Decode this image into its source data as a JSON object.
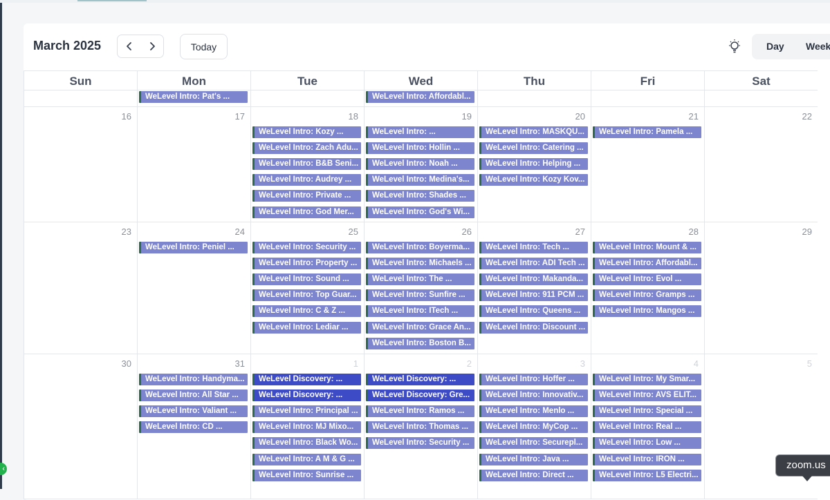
{
  "calendar": {
    "month_title": "March 2025",
    "nav": {
      "prev_icon": "chevron-left-icon",
      "next_icon": "chevron-right-icon"
    },
    "today_label": "Today",
    "theme_icon": "lightbulb-icon",
    "views": [
      "Day",
      "Week"
    ],
    "weekdays": [
      "Sun",
      "Mon",
      "Tue",
      "Wed",
      "Thu",
      "Fri",
      "Sat"
    ],
    "colors": {
      "event": "#7e85cf",
      "event_discovery": "#3e4bc6",
      "event_stripe": "#2e6b4a"
    },
    "weeks": [
      {
        "days": [
          {
            "num": "",
            "other": false,
            "events": []
          },
          {
            "num": "",
            "other": false,
            "events": [
              {
                "title": "WeLevel Intro: Pat's ...",
                "kind": "intro"
              }
            ]
          },
          {
            "num": "",
            "other": false,
            "events": []
          },
          {
            "num": "",
            "other": false,
            "events": [
              {
                "title": "WeLevel Intro: Affordabl...",
                "kind": "intro"
              }
            ]
          },
          {
            "num": "",
            "other": false,
            "events": []
          },
          {
            "num": "",
            "other": false,
            "events": []
          },
          {
            "num": "",
            "other": false,
            "events": []
          }
        ]
      },
      {
        "days": [
          {
            "num": "16",
            "other": false,
            "events": []
          },
          {
            "num": "17",
            "other": false,
            "events": []
          },
          {
            "num": "18",
            "other": false,
            "events": [
              {
                "title": "WeLevel Intro: Kozy ...",
                "kind": "intro"
              },
              {
                "title": "WeLevel Intro: Zach Adu...",
                "kind": "intro"
              },
              {
                "title": "WeLevel Intro: B&B Seni...",
                "kind": "intro"
              },
              {
                "title": "WeLevel Intro: Audrey ...",
                "kind": "intro"
              },
              {
                "title": "WeLevel Intro: Private ...",
                "kind": "intro"
              },
              {
                "title": "WeLevel Intro: God Mer...",
                "kind": "intro"
              }
            ]
          },
          {
            "num": "19",
            "other": false,
            "events": [
              {
                "title": "WeLevel Intro: ...",
                "kind": "intro"
              },
              {
                "title": "WeLevel Intro: Hollin ...",
                "kind": "intro"
              },
              {
                "title": "WeLevel Intro: Noah ...",
                "kind": "intro"
              },
              {
                "title": "WeLevel Intro: Medina's...",
                "kind": "intro"
              },
              {
                "title": "WeLevel Intro: Shades ...",
                "kind": "intro"
              },
              {
                "title": "WeLevel Intro: God's Wi...",
                "kind": "intro"
              }
            ]
          },
          {
            "num": "20",
            "other": false,
            "events": [
              {
                "title": "WeLevel Intro: MASKQU...",
                "kind": "intro"
              },
              {
                "title": "WeLevel Intro: Catering ...",
                "kind": "intro"
              },
              {
                "title": "WeLevel Intro: Helping ...",
                "kind": "intro"
              },
              {
                "title": "WeLevel Intro: Kozy Kov...",
                "kind": "intro"
              }
            ]
          },
          {
            "num": "21",
            "other": false,
            "events": [
              {
                "title": "WeLevel Intro: Pamela ...",
                "kind": "intro"
              }
            ]
          },
          {
            "num": "22",
            "other": false,
            "events": []
          }
        ]
      },
      {
        "days": [
          {
            "num": "23",
            "other": false,
            "events": []
          },
          {
            "num": "24",
            "other": false,
            "events": [
              {
                "title": "WeLevel Intro: Peniel ...",
                "kind": "intro"
              }
            ]
          },
          {
            "num": "25",
            "other": false,
            "events": [
              {
                "title": "WeLevel Intro: Security ...",
                "kind": "intro"
              },
              {
                "title": "WeLevel Intro: Property ...",
                "kind": "intro"
              },
              {
                "title": "WeLevel Intro: Sound ...",
                "kind": "intro"
              },
              {
                "title": "WeLevel Intro: Top Guar...",
                "kind": "intro"
              },
              {
                "title": "WeLevel Intro: C & Z ...",
                "kind": "intro"
              },
              {
                "title": "WeLevel Intro: Lediar ...",
                "kind": "intro"
              }
            ]
          },
          {
            "num": "26",
            "other": false,
            "events": [
              {
                "title": "WeLevel Intro: Boyerma...",
                "kind": "intro"
              },
              {
                "title": "WeLevel Intro: Michaels ...",
                "kind": "intro"
              },
              {
                "title": "WeLevel Intro: The ...",
                "kind": "intro"
              },
              {
                "title": "WeLevel Intro: Sunfire ...",
                "kind": "intro"
              },
              {
                "title": "WeLevel Intro: ITech ...",
                "kind": "intro"
              },
              {
                "title": "WeLevel Intro: Grace An...",
                "kind": "intro"
              },
              {
                "title": "WeLevel Intro: Boston B...",
                "kind": "intro"
              }
            ]
          },
          {
            "num": "27",
            "other": false,
            "events": [
              {
                "title": "WeLevel Intro: Tech ...",
                "kind": "intro"
              },
              {
                "title": "WeLevel Intro: ADI Tech ...",
                "kind": "intro"
              },
              {
                "title": "WeLevel Intro: Makanda...",
                "kind": "intro"
              },
              {
                "title": "WeLevel Intro: 911 PCM ...",
                "kind": "intro"
              },
              {
                "title": "WeLevel Intro: Queens ...",
                "kind": "intro"
              },
              {
                "title": "WeLevel Intro: Discount ...",
                "kind": "intro"
              }
            ]
          },
          {
            "num": "28",
            "other": false,
            "events": [
              {
                "title": "WeLevel Intro: Mount & ...",
                "kind": "intro"
              },
              {
                "title": "WeLevel Intro: Affordabl...",
                "kind": "intro"
              },
              {
                "title": "WeLevel Intro: Evol ...",
                "kind": "intro"
              },
              {
                "title": "WeLevel Intro: Gramps ...",
                "kind": "intro"
              },
              {
                "title": "WeLevel Intro: Mangos ...",
                "kind": "intro"
              }
            ]
          },
          {
            "num": "29",
            "other": false,
            "events": []
          }
        ]
      },
      {
        "days": [
          {
            "num": "30",
            "other": false,
            "events": []
          },
          {
            "num": "31",
            "other": false,
            "events": [
              {
                "title": "WeLevel Intro: Handyma...",
                "kind": "intro"
              },
              {
                "title": "WeLevel Intro: All Star ...",
                "kind": "intro"
              },
              {
                "title": "WeLevel Intro: Valiant ...",
                "kind": "intro"
              },
              {
                "title": "WeLevel Intro: CD ...",
                "kind": "intro"
              }
            ]
          },
          {
            "num": "1",
            "other": true,
            "events": [
              {
                "title": "WeLevel Discovery: ...",
                "kind": "discovery"
              },
              {
                "title": "WeLevel Discovery: ...",
                "kind": "discovery"
              },
              {
                "title": "WeLevel Intro: Principal ...",
                "kind": "intro"
              },
              {
                "title": "WeLevel Intro: MJ Mixo...",
                "kind": "intro"
              },
              {
                "title": "WeLevel Intro: Black Wo...",
                "kind": "intro"
              },
              {
                "title": "WeLevel Intro: A M & G ...",
                "kind": "intro"
              },
              {
                "title": "WeLevel Intro: Sunrise ...",
                "kind": "intro"
              }
            ]
          },
          {
            "num": "2",
            "other": true,
            "events": [
              {
                "title": "WeLevel Discovery: ...",
                "kind": "discovery"
              },
              {
                "title": "WeLevel Discovery: Gre...",
                "kind": "discovery"
              },
              {
                "title": "WeLevel Intro: Ramos ...",
                "kind": "intro"
              },
              {
                "title": "WeLevel Intro: Thomas ...",
                "kind": "intro"
              },
              {
                "title": "WeLevel Intro: Security ...",
                "kind": "intro"
              }
            ]
          },
          {
            "num": "3",
            "other": true,
            "events": [
              {
                "title": "WeLevel Intro: Hoffer ...",
                "kind": "intro"
              },
              {
                "title": "WeLevel Intro: Innovativ...",
                "kind": "intro"
              },
              {
                "title": "WeLevel Intro: Menlo ...",
                "kind": "intro"
              },
              {
                "title": "WeLevel Intro: MyCop ...",
                "kind": "intro"
              },
              {
                "title": "WeLevel Intro: Securepl...",
                "kind": "intro"
              },
              {
                "title": "WeLevel Intro: Java ...",
                "kind": "intro"
              },
              {
                "title": "WeLevel Intro: Direct ...",
                "kind": "intro"
              }
            ]
          },
          {
            "num": "4",
            "other": true,
            "events": [
              {
                "title": "WeLevel Intro: My Smar...",
                "kind": "intro"
              },
              {
                "title": "WeLevel Intro: AVS ELIT...",
                "kind": "intro"
              },
              {
                "title": "WeLevel Intro: Special ...",
                "kind": "intro"
              },
              {
                "title": "WeLevel Intro: Real ...",
                "kind": "intro"
              },
              {
                "title": "WeLevel Intro: Low ...",
                "kind": "intro"
              },
              {
                "title": "WeLevel Intro: IRON ...",
                "kind": "intro"
              },
              {
                "title": "WeLevel Intro: L5 Electri...",
                "kind": "intro"
              }
            ]
          },
          {
            "num": "5",
            "other": true,
            "events": []
          }
        ]
      }
    ]
  },
  "overlay": {
    "zoom_tooltip": "zoom.us"
  }
}
